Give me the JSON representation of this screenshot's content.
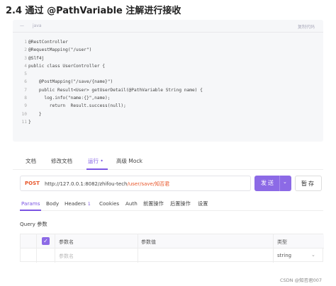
{
  "heading": "2.4 通过 @PathVariable 注解进行接收",
  "code": {
    "dash": "—",
    "lang": "java",
    "copy_label": "复制代码",
    "lines": [
      {
        "num": "1",
        "text": "@RestController"
      },
      {
        "num": "2",
        "text": "@RequestMapping(\"/user\")"
      },
      {
        "num": "3",
        "text": "@Slf4j"
      },
      {
        "num": "4",
        "text": "public class UserController {"
      },
      {
        "num": "5",
        "text": ""
      },
      {
        "num": "6",
        "text": "    @PostMapping(\"/save/{name}\")"
      },
      {
        "num": "7",
        "text": "    public Result<User> getUserDetail(@PathVariable String name) {"
      },
      {
        "num": "8",
        "text": "      log.info(\"name:{}\",name);"
      },
      {
        "num": "9",
        "text": "        return  Result.success(null);"
      },
      {
        "num": "10",
        "text": "    }"
      },
      {
        "num": "11",
        "text": "}"
      }
    ]
  },
  "top_tabs": {
    "docs": "文档",
    "edit_docs": "修改文档",
    "run": "运行 •",
    "mock": "高级 Mock"
  },
  "request": {
    "method": "POST",
    "url_prefix": "http://127.0.0.1:8082/zhifou-tech",
    "url_path": "/user/save/知否君",
    "send_label": "发送",
    "send_chevron": "⌄",
    "save_label": "暂存"
  },
  "sub_tabs": {
    "params": "Params",
    "body": "Body",
    "headers": "Headers",
    "headers_count": "1",
    "cookies": "Cookies",
    "auth": "Auth",
    "pre": "前置操作",
    "post": "后置操作",
    "settings": "设置"
  },
  "query": {
    "title": "Query 参数",
    "col_name": "参数名",
    "col_value": "参数值",
    "col_type": "类型",
    "row_name_placeholder": "参数名",
    "row_type": "string",
    "check": "✓",
    "chevron": "⌄"
  },
  "watermark": "CSDN @知否君007",
  "colors": {
    "accent": "#8c6ae6",
    "method": "#e8562a"
  }
}
